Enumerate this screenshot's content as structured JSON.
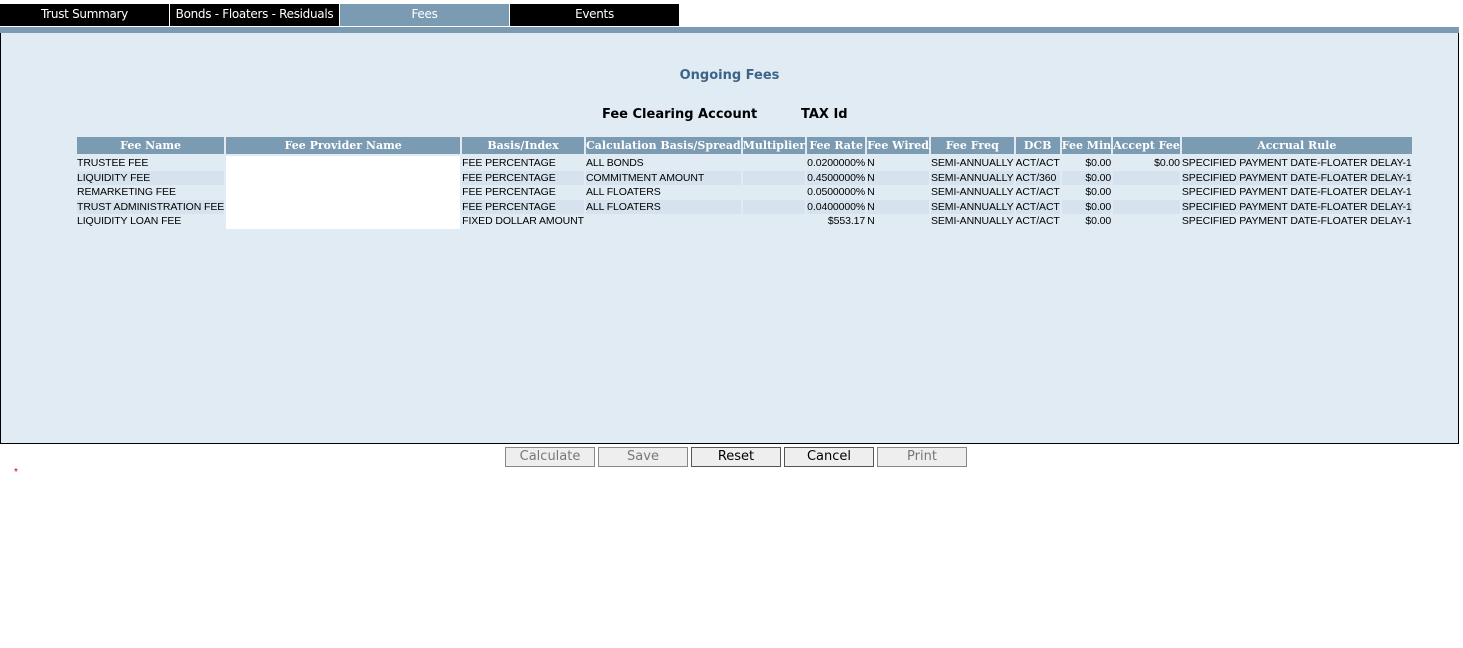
{
  "tabs": [
    {
      "label": "Trust Summary",
      "active": false
    },
    {
      "label": "Bonds - Floaters - Residuals",
      "active": false
    },
    {
      "label": "Fees",
      "active": true
    },
    {
      "label": "Events",
      "active": false
    }
  ],
  "section": {
    "title": "Ongoing Fees",
    "fee_clearing_account_label": "Fee Clearing Account",
    "tax_id_label": "TAX Id"
  },
  "table": {
    "headers": [
      "Fee Name",
      "Fee Provider Name",
      "Basis/Index",
      "Calculation Basis/Spread",
      "Multiplier",
      "Fee Rate",
      "Fee Wired",
      "Fee Freq",
      "DCB",
      "Fee Min",
      "Accept Fee",
      "Accrual Rule"
    ],
    "rows": [
      [
        "TRUSTEE FEE",
        "",
        "FEE PERCENTAGE",
        "ALL BONDS",
        "",
        "0.0200000%",
        "N",
        "SEMI-ANNUALLY",
        "ACT/ACT",
        "$0.00",
        "$0.00",
        "SPECIFIED PAYMENT DATE-FLOATER DELAY-1"
      ],
      [
        "LIQUIDITY FEE",
        "",
        "FEE PERCENTAGE",
        "COMMITMENT AMOUNT",
        "",
        "0.4500000%",
        "N",
        "SEMI-ANNUALLY",
        "ACT/360",
        "$0.00",
        "",
        "SPECIFIED PAYMENT DATE-FLOATER DELAY-1"
      ],
      [
        "REMARKETING FEE",
        "",
        "FEE PERCENTAGE",
        "ALL FLOATERS",
        "",
        "0.0500000%",
        "N",
        "SEMI-ANNUALLY",
        "ACT/ACT",
        "$0.00",
        "",
        "SPECIFIED PAYMENT DATE-FLOATER DELAY-1"
      ],
      [
        "TRUST ADMINISTRATION FEE",
        "",
        "FEE PERCENTAGE",
        "ALL FLOATERS",
        "",
        "0.0400000%",
        "N",
        "SEMI-ANNUALLY",
        "ACT/ACT",
        "$0.00",
        "",
        "SPECIFIED PAYMENT DATE-FLOATER DELAY-1"
      ],
      [
        "LIQUIDITY LOAN FEE",
        "",
        "FIXED DOLLAR AMOUNT",
        "",
        "",
        "$553.17",
        "N",
        "SEMI-ANNUALLY",
        "ACT/ACT",
        "$0.00",
        "",
        "SPECIFIED PAYMENT DATE-FLOATER DELAY-1"
      ]
    ]
  },
  "buttons": [
    {
      "label": "Calculate",
      "enabled": false
    },
    {
      "label": "Save",
      "enabled": false
    },
    {
      "label": "Reset",
      "enabled": true
    },
    {
      "label": "Cancel",
      "enabled": true
    },
    {
      "label": "Print",
      "enabled": false
    }
  ],
  "required_marker": "*",
  "colors": {
    "tab_active": "#7b9bb3",
    "tab_inactive": "#000000",
    "panel_bg": "#e1ebf4",
    "header_bg": "#7b9bb3",
    "title": "#3a6589"
  }
}
